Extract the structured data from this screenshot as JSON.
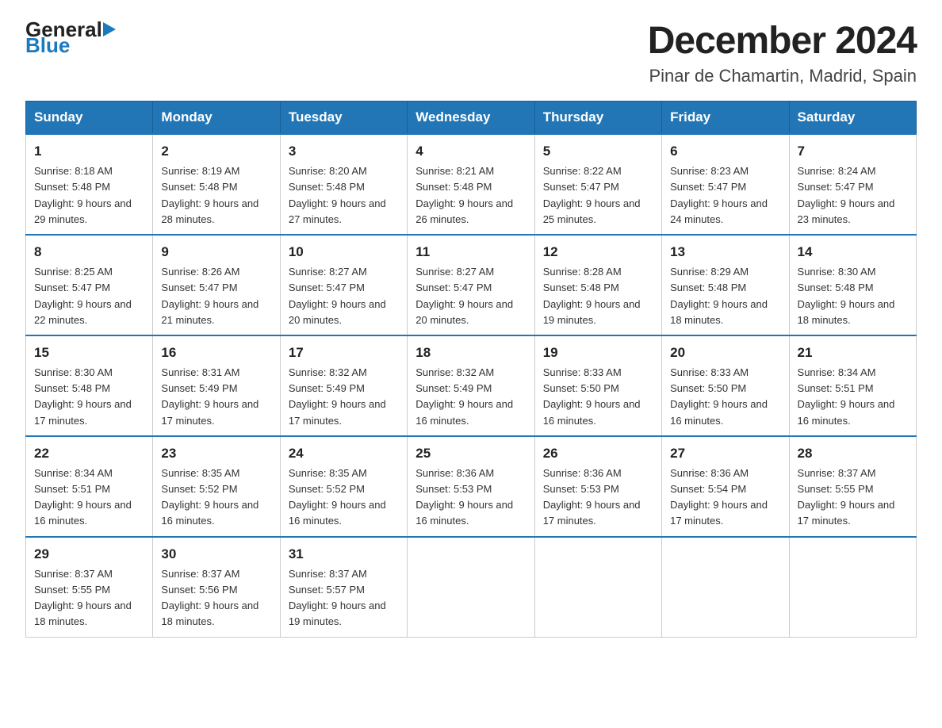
{
  "logo": {
    "general": "General",
    "blue": "Blue"
  },
  "header": {
    "title": "December 2024",
    "subtitle": "Pinar de Chamartin, Madrid, Spain"
  },
  "days_of_week": [
    "Sunday",
    "Monday",
    "Tuesday",
    "Wednesday",
    "Thursday",
    "Friday",
    "Saturday"
  ],
  "weeks": [
    [
      {
        "day": "1",
        "sunrise": "8:18 AM",
        "sunset": "5:48 PM",
        "daylight": "9 hours and 29 minutes."
      },
      {
        "day": "2",
        "sunrise": "8:19 AM",
        "sunset": "5:48 PM",
        "daylight": "9 hours and 28 minutes."
      },
      {
        "day": "3",
        "sunrise": "8:20 AM",
        "sunset": "5:48 PM",
        "daylight": "9 hours and 27 minutes."
      },
      {
        "day": "4",
        "sunrise": "8:21 AM",
        "sunset": "5:48 PM",
        "daylight": "9 hours and 26 minutes."
      },
      {
        "day": "5",
        "sunrise": "8:22 AM",
        "sunset": "5:47 PM",
        "daylight": "9 hours and 25 minutes."
      },
      {
        "day": "6",
        "sunrise": "8:23 AM",
        "sunset": "5:47 PM",
        "daylight": "9 hours and 24 minutes."
      },
      {
        "day": "7",
        "sunrise": "8:24 AM",
        "sunset": "5:47 PM",
        "daylight": "9 hours and 23 minutes."
      }
    ],
    [
      {
        "day": "8",
        "sunrise": "8:25 AM",
        "sunset": "5:47 PM",
        "daylight": "9 hours and 22 minutes."
      },
      {
        "day": "9",
        "sunrise": "8:26 AM",
        "sunset": "5:47 PM",
        "daylight": "9 hours and 21 minutes."
      },
      {
        "day": "10",
        "sunrise": "8:27 AM",
        "sunset": "5:47 PM",
        "daylight": "9 hours and 20 minutes."
      },
      {
        "day": "11",
        "sunrise": "8:27 AM",
        "sunset": "5:47 PM",
        "daylight": "9 hours and 20 minutes."
      },
      {
        "day": "12",
        "sunrise": "8:28 AM",
        "sunset": "5:48 PM",
        "daylight": "9 hours and 19 minutes."
      },
      {
        "day": "13",
        "sunrise": "8:29 AM",
        "sunset": "5:48 PM",
        "daylight": "9 hours and 18 minutes."
      },
      {
        "day": "14",
        "sunrise": "8:30 AM",
        "sunset": "5:48 PM",
        "daylight": "9 hours and 18 minutes."
      }
    ],
    [
      {
        "day": "15",
        "sunrise": "8:30 AM",
        "sunset": "5:48 PM",
        "daylight": "9 hours and 17 minutes."
      },
      {
        "day": "16",
        "sunrise": "8:31 AM",
        "sunset": "5:49 PM",
        "daylight": "9 hours and 17 minutes."
      },
      {
        "day": "17",
        "sunrise": "8:32 AM",
        "sunset": "5:49 PM",
        "daylight": "9 hours and 17 minutes."
      },
      {
        "day": "18",
        "sunrise": "8:32 AM",
        "sunset": "5:49 PM",
        "daylight": "9 hours and 16 minutes."
      },
      {
        "day": "19",
        "sunrise": "8:33 AM",
        "sunset": "5:50 PM",
        "daylight": "9 hours and 16 minutes."
      },
      {
        "day": "20",
        "sunrise": "8:33 AM",
        "sunset": "5:50 PM",
        "daylight": "9 hours and 16 minutes."
      },
      {
        "day": "21",
        "sunrise": "8:34 AM",
        "sunset": "5:51 PM",
        "daylight": "9 hours and 16 minutes."
      }
    ],
    [
      {
        "day": "22",
        "sunrise": "8:34 AM",
        "sunset": "5:51 PM",
        "daylight": "9 hours and 16 minutes."
      },
      {
        "day": "23",
        "sunrise": "8:35 AM",
        "sunset": "5:52 PM",
        "daylight": "9 hours and 16 minutes."
      },
      {
        "day": "24",
        "sunrise": "8:35 AM",
        "sunset": "5:52 PM",
        "daylight": "9 hours and 16 minutes."
      },
      {
        "day": "25",
        "sunrise": "8:36 AM",
        "sunset": "5:53 PM",
        "daylight": "9 hours and 16 minutes."
      },
      {
        "day": "26",
        "sunrise": "8:36 AM",
        "sunset": "5:53 PM",
        "daylight": "9 hours and 17 minutes."
      },
      {
        "day": "27",
        "sunrise": "8:36 AM",
        "sunset": "5:54 PM",
        "daylight": "9 hours and 17 minutes."
      },
      {
        "day": "28",
        "sunrise": "8:37 AM",
        "sunset": "5:55 PM",
        "daylight": "9 hours and 17 minutes."
      }
    ],
    [
      {
        "day": "29",
        "sunrise": "8:37 AM",
        "sunset": "5:55 PM",
        "daylight": "9 hours and 18 minutes."
      },
      {
        "day": "30",
        "sunrise": "8:37 AM",
        "sunset": "5:56 PM",
        "daylight": "9 hours and 18 minutes."
      },
      {
        "day": "31",
        "sunrise": "8:37 AM",
        "sunset": "5:57 PM",
        "daylight": "9 hours and 19 minutes."
      },
      null,
      null,
      null,
      null
    ]
  ]
}
